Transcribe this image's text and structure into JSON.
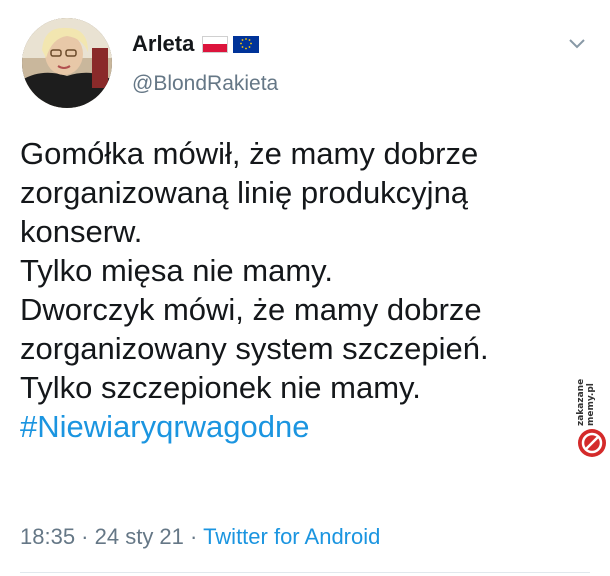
{
  "author": {
    "display_name": "Arleta",
    "handle": "@BlondRakieta",
    "flags": [
      "poland-flag-icon",
      "eu-flag-icon"
    ]
  },
  "menu": {
    "icon": "chevron-down-icon"
  },
  "tweet": {
    "lines": [
      "Gomółka mówił, że mamy dobrze",
      "zorganizowaną linię produkcyjną",
      "konserw.",
      "Tylko mięsa nie mamy.",
      "Dworczyk mówi, że mamy dobrze",
      "zorganizowany system szczepień.",
      "Tylko szczepionek nie mamy."
    ],
    "hashtag": "#Niewiaryqrwagodne"
  },
  "meta": {
    "time": "18:35",
    "separator": " · ",
    "date": "24 sty 21",
    "source": "Twitter for Android"
  },
  "watermark": {
    "text": "zakazane memy.pl"
  },
  "colors": {
    "text": "#14171a",
    "secondary": "#657786",
    "link": "#1b95e0",
    "flag_red": "#dc143c",
    "eu_blue": "#003399",
    "eu_gold": "#ffcc00"
  }
}
